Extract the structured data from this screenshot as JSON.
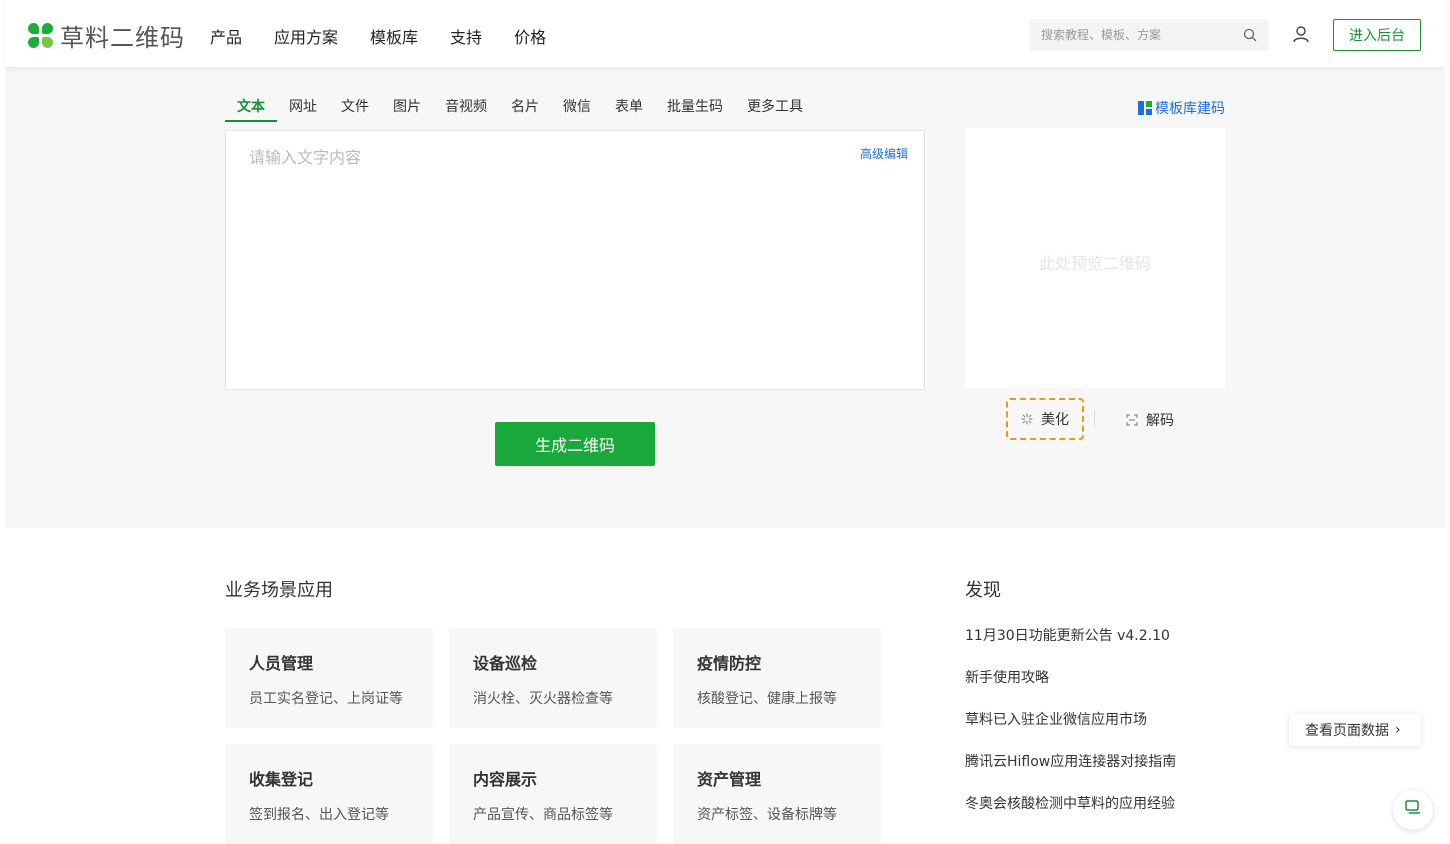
{
  "brand": {
    "name": "草料二维码",
    "color": "#1aa83c"
  },
  "nav": [
    "产品",
    "应用方案",
    "模板库",
    "支持",
    "价格"
  ],
  "header": {
    "search_placeholder": "搜索教程、模板、方案",
    "backend_button": "进入后台"
  },
  "generator": {
    "tabs": [
      "文本",
      "网址",
      "文件",
      "图片",
      "音视频",
      "名片",
      "微信",
      "表单",
      "批量生码",
      "更多工具"
    ],
    "active_tab": "文本",
    "template_link": "模板库建码",
    "input_placeholder": "请输入文字内容",
    "advanced_edit": "高级编辑",
    "generate_button": "生成二维码",
    "preview_placeholder": "此处预览二维码",
    "beautify": "美化",
    "decode": "解码"
  },
  "scenes": {
    "title": "业务场景应用",
    "cards": [
      {
        "title": "人员管理",
        "desc": "员工实名登记、上岗证等"
      },
      {
        "title": "设备巡检",
        "desc": "消火栓、灭火器检查等"
      },
      {
        "title": "疫情防控",
        "desc": "核酸登记、健康上报等"
      },
      {
        "title": "收集登记",
        "desc": "签到报名、出入登记等"
      },
      {
        "title": "内容展示",
        "desc": "产品宣传、商品标签等"
      },
      {
        "title": "资产管理",
        "desc": "资产标签、设备标牌等"
      }
    ]
  },
  "discover": {
    "title": "发现",
    "items": [
      "11月30日功能更新公告 v4.2.10",
      "新手使用攻略",
      "草料已入驻企业微信应用市场",
      "腾讯云Hiflow应用连接器对接指南",
      "冬奥会核酸检测中草料的应用经验"
    ]
  },
  "floating": {
    "view_data": "查看页面数据",
    "chevron": "›"
  }
}
